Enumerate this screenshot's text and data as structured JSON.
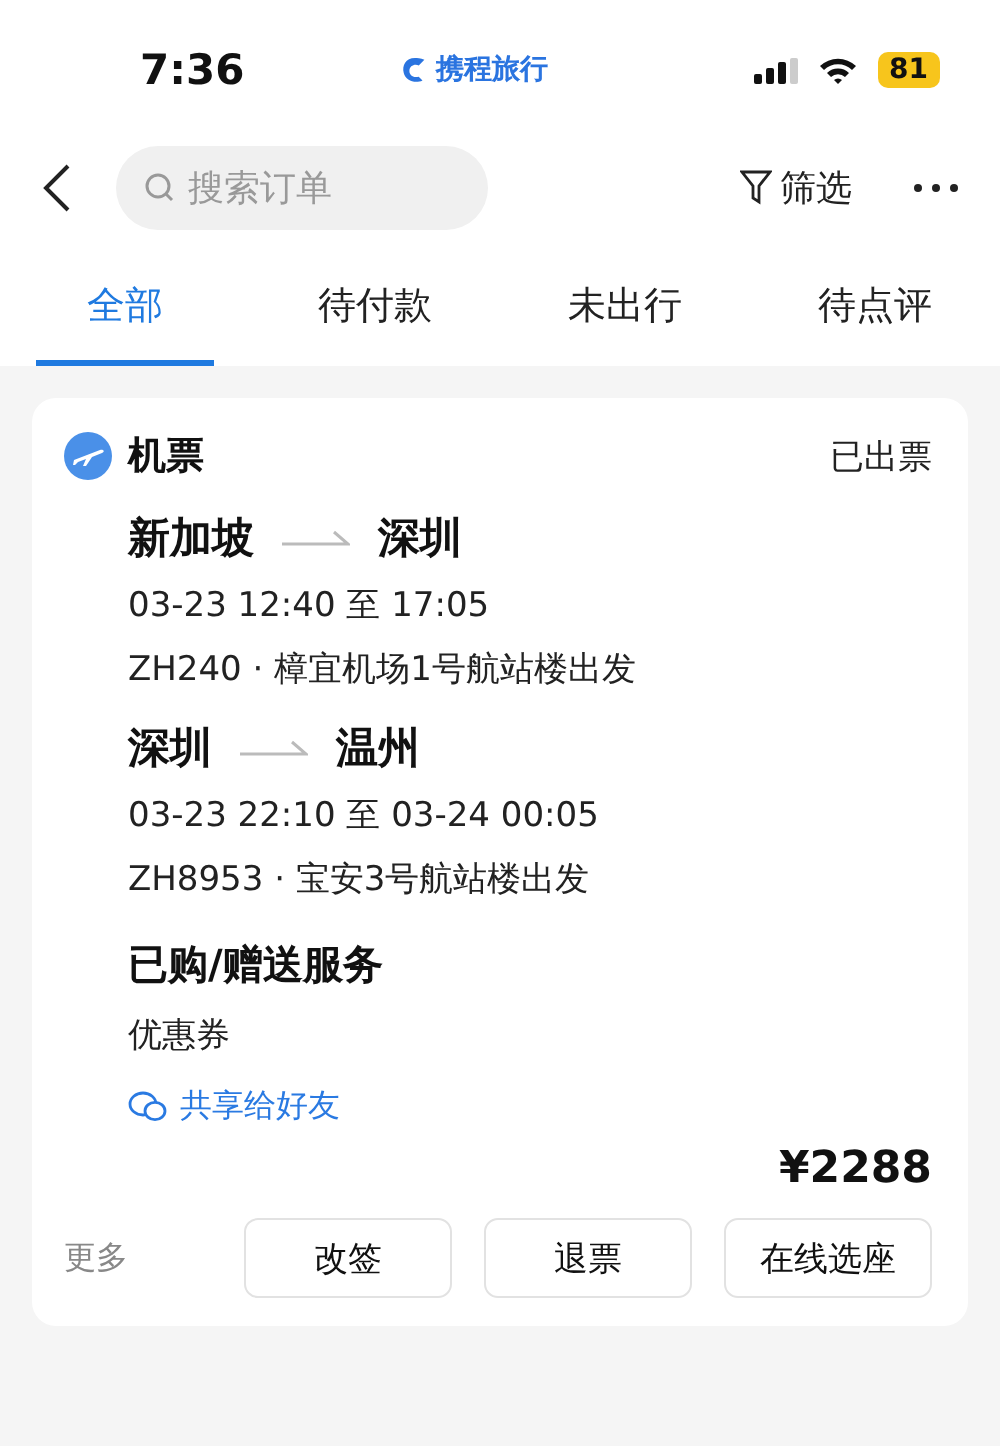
{
  "status_bar": {
    "time": "7:36",
    "app": "携程旅行",
    "battery": "81"
  },
  "header": {
    "search": {
      "placeholder": "搜索订单"
    },
    "filter": "筛选"
  },
  "tabs": [
    {
      "label": "全部",
      "selected": true
    },
    {
      "label": "待付款",
      "selected": false
    },
    {
      "label": "未出行",
      "selected": false
    },
    {
      "label": "待点评",
      "selected": false
    }
  ],
  "order": {
    "category": "机票",
    "status": "已出票",
    "flights": [
      {
        "from": "新加坡",
        "to": "深圳",
        "time": "03-23 12:40 至 17:05",
        "detail": "ZH240 · 樟宜机场1号航站楼出发"
      },
      {
        "from": "深圳",
        "to": "温州",
        "time": "03-23 22:10 至 03-24 00:05",
        "detail": "ZH8953 · 宝安3号航站楼出发"
      }
    ],
    "services_title": "已购/赠送服务",
    "service": "优惠券",
    "share": "共享给好友",
    "price": "¥2288",
    "more": "更多",
    "buttons": [
      "改签",
      "退票",
      "在线选座"
    ]
  }
}
